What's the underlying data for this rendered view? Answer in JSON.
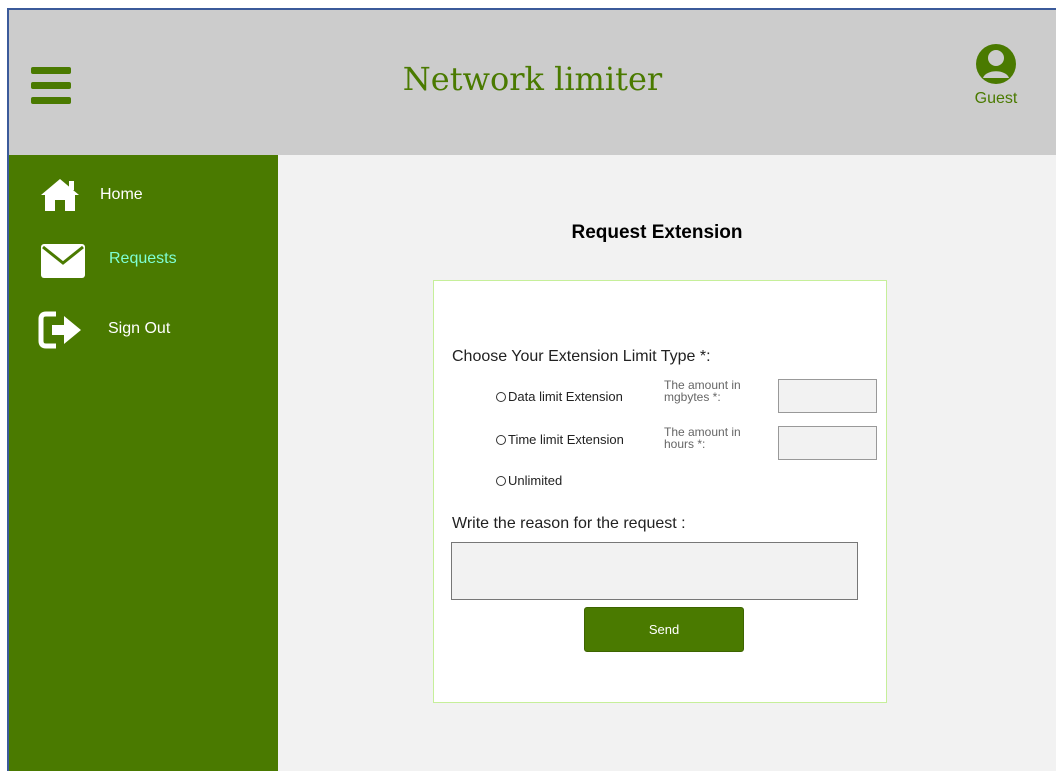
{
  "header": {
    "title": "Network limiter",
    "user_label": "Guest"
  },
  "sidebar": {
    "items": [
      {
        "label": "Home",
        "icon": "home-icon",
        "active": false
      },
      {
        "label": "Requests",
        "icon": "envelope-icon",
        "active": true
      },
      {
        "label": "Sign Out",
        "icon": "sign-out-icon",
        "active": false
      }
    ]
  },
  "main": {
    "title": "Request Extension",
    "form": {
      "limit_type_label": "Choose Your Extension Limit Type *:",
      "options": [
        {
          "label": "Data limit Extension",
          "amount_label_line1": "The amount in",
          "amount_label_line2": "mgbytes *:",
          "value": ""
        },
        {
          "label": "Time limit Extension",
          "amount_label_line1": "The amount in",
          "amount_label_line2": "hours *:",
          "value": ""
        },
        {
          "label": "Unlimited"
        }
      ],
      "reason_label": "Write the reason for the request :",
      "reason_value": "",
      "send_label": "Send"
    }
  },
  "colors": {
    "brand": "#4a7a00",
    "header_bg": "#cccccc",
    "content_bg": "#f2f2f2",
    "active_nav": "#7fffd4"
  }
}
